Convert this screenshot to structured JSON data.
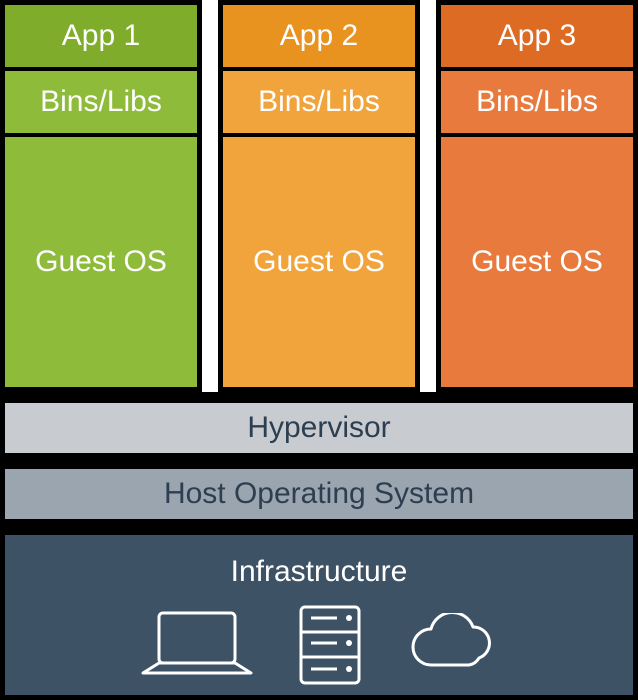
{
  "vms": [
    {
      "app": "App 1",
      "bins": "Bins/Libs",
      "guest": "Guest OS",
      "color": "green"
    },
    {
      "app": "App 2",
      "bins": "Bins/Libs",
      "guest": "Guest OS",
      "color": "orange"
    },
    {
      "app": "App 3",
      "bins": "Bins/Libs",
      "guest": "Guest OS",
      "color": "red"
    }
  ],
  "layers": {
    "hypervisor": "Hypervisor",
    "host": "Host Operating System",
    "infrastructure": "Infrastructure"
  },
  "colors": {
    "green_dark": "#80ac2b",
    "green": "#8fbb3b",
    "orange_dark": "#e8921f",
    "orange": "#f1a43c",
    "red_dark": "#dd6b24",
    "red": "#e77a3c",
    "hypervisor_bg": "#c8ccd0",
    "host_bg": "#9ba5af",
    "infra_bg": "#3e5265"
  },
  "icons": [
    "laptop-icon",
    "server-icon",
    "cloud-icon"
  ]
}
